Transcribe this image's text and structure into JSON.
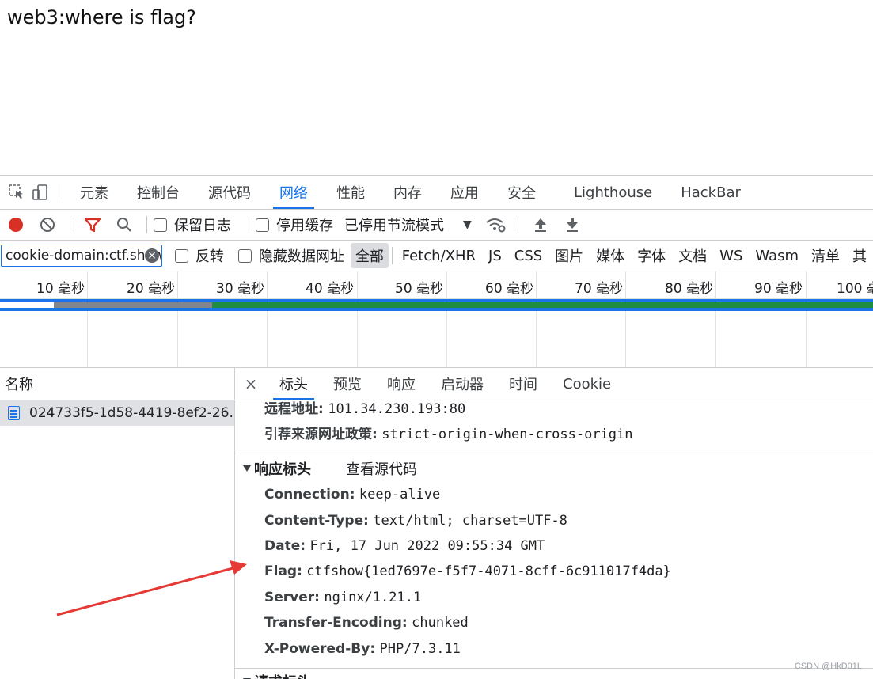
{
  "page": {
    "text": "web3:where is flag?"
  },
  "main_tabs": [
    "元素",
    "控制台",
    "源代码",
    "网络",
    "性能",
    "内存",
    "应用",
    "安全",
    "Lighthouse",
    "HackBar"
  ],
  "toolbar": {
    "preserve_log": "保留日志",
    "disable_cache": "停用缓存",
    "throttling": "已停用节流模式"
  },
  "filter": {
    "value": "cookie-domain:ctf.show coo",
    "invert": "反转",
    "hide_data_urls": "隐藏数据网址",
    "types": [
      "全部",
      "Fetch/XHR",
      "JS",
      "CSS",
      "图片",
      "媒体",
      "字体",
      "文档",
      "WS",
      "Wasm",
      "清单",
      "其"
    ]
  },
  "timeline": {
    "labels": [
      "10 毫秒",
      "20 毫秒",
      "30 毫秒",
      "40 毫秒",
      "50 毫秒",
      "60 毫秒",
      "70 毫秒",
      "80 毫秒",
      "90 毫秒",
      "100 毫"
    ]
  },
  "names": {
    "header": "名称",
    "row": "024733f5-1d58-4419-8ef2-26..."
  },
  "details": {
    "tabs": [
      "标头",
      "预览",
      "响应",
      "启动器",
      "时间",
      "Cookie"
    ],
    "general": [
      {
        "k": "远程地址:",
        "v": "101.34.230.193:80"
      },
      {
        "k": "引荐来源网址政策:",
        "v": "strict-origin-when-cross-origin"
      }
    ],
    "response_section": "响应标头",
    "view_source": "查看源代码",
    "response_headers": [
      {
        "k": "Connection:",
        "v": "keep-alive"
      },
      {
        "k": "Content-Type:",
        "v": "text/html; charset=UTF-8"
      },
      {
        "k": "Date:",
        "v": "Fri, 17 Jun 2022 09:55:34 GMT"
      },
      {
        "k": "Flag:",
        "v": "ctfshow{1ed7697e-f5f7-4071-8cff-6c911017f4da}"
      },
      {
        "k": "Server:",
        "v": "nginx/1.21.1"
      },
      {
        "k": "Transfer-Encoding:",
        "v": "chunked"
      },
      {
        "k": "X-Powered-By:",
        "v": "PHP/7.3.11"
      }
    ],
    "next_section": "请求标头"
  },
  "watermark": "CSDN @HkD01L",
  "colors": {
    "accent": "#1a73e8",
    "record": "#d93025",
    "arrow": "#e53935",
    "bar_green": "#1e8e3e"
  }
}
